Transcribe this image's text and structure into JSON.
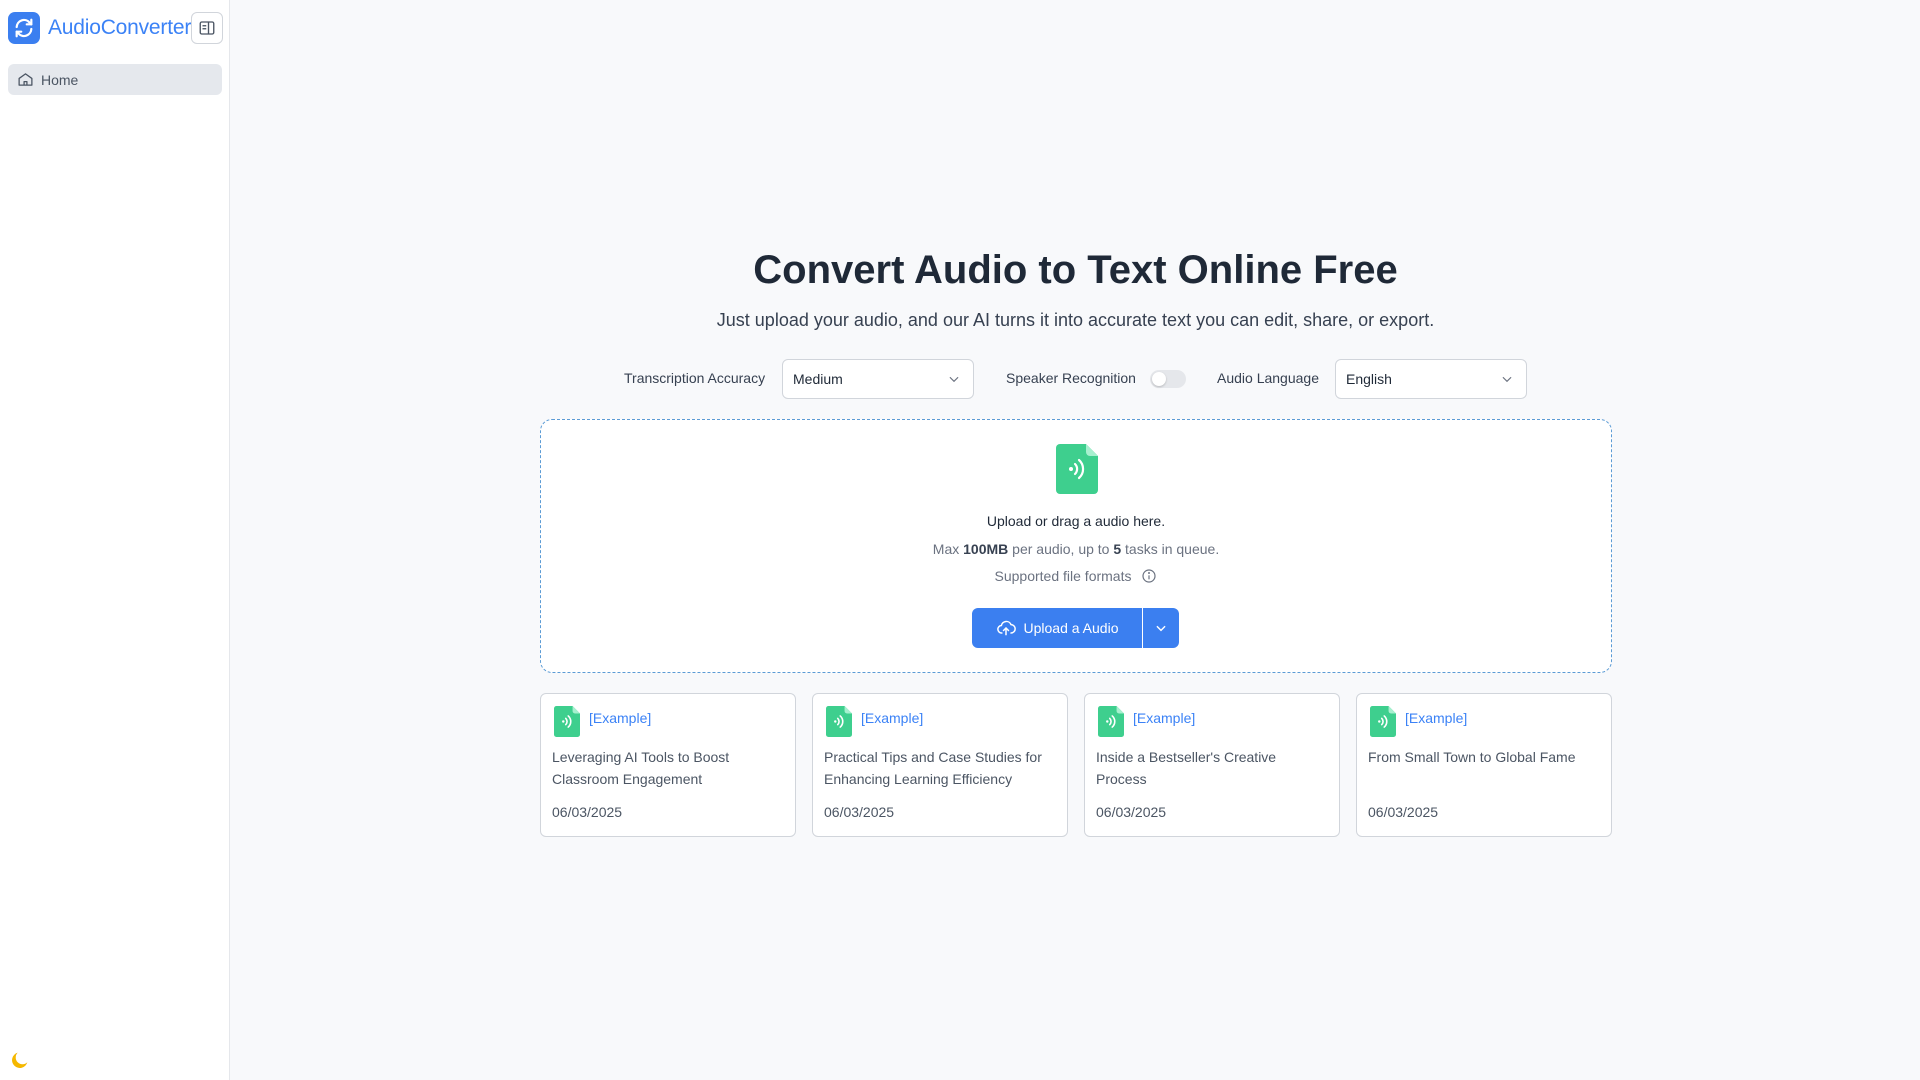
{
  "app": {
    "name": "AudioConverter"
  },
  "sidebar": {
    "items": [
      {
        "label": "Home",
        "icon": "home-icon"
      }
    ]
  },
  "colors": {
    "accent": "#3b7ff0",
    "file_icon": "#3ecf8e",
    "moon": "#f5b800"
  },
  "hero": {
    "title": "Convert Audio to Text Online Free",
    "subtitle": "Just upload your audio, and our AI turns it into accurate text you can edit, share, or export."
  },
  "options": {
    "accuracy_label": "Transcription Accuracy",
    "accuracy_value": "Medium",
    "speaker_label": "Speaker Recognition",
    "speaker_enabled": false,
    "language_label": "Audio Language",
    "language_value": "English"
  },
  "upload": {
    "prompt": "Upload or drag a audio here.",
    "limits_pre": "Max ",
    "limits_size": "100MB",
    "limits_mid": " per audio, up to ",
    "limits_count": "5",
    "limits_post": " tasks in queue.",
    "formats_label": "Supported file formats",
    "button_label": "Upload a Audio"
  },
  "examples": [
    {
      "tag": "[Example]",
      "title": "Leveraging AI Tools to Boost Classroom Engagement",
      "date": "06/03/2025"
    },
    {
      "tag": "[Example]",
      "title": "Practical Tips and Case Studies for Enhancing Learning Efficiency",
      "date": "06/03/2025"
    },
    {
      "tag": "[Example]",
      "title": "Inside a Bestseller's Creative Process",
      "date": "06/03/2025"
    },
    {
      "tag": "[Example]",
      "title": "From Small Town to Global Fame",
      "date": "06/03/2025"
    }
  ]
}
